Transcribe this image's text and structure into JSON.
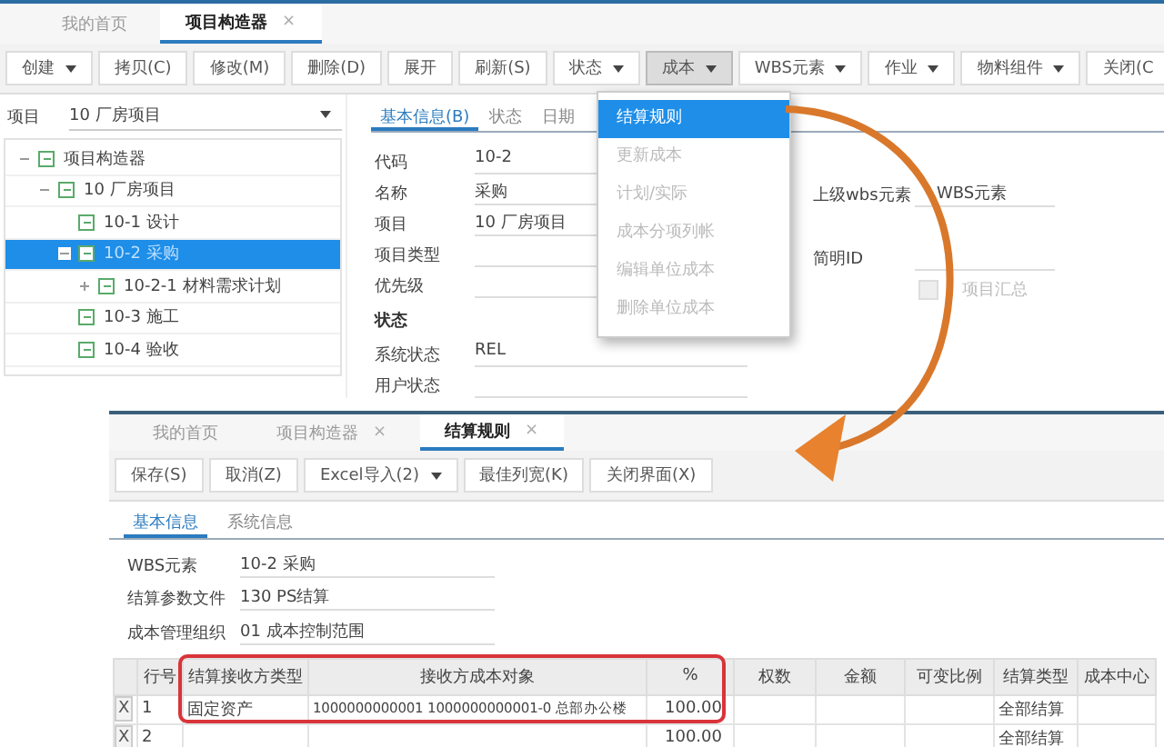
{
  "project_window": {
    "tabs": [
      {
        "label": "我的首页",
        "selected": false
      },
      {
        "label": "项目构造器",
        "selected": true,
        "close": "×"
      }
    ],
    "toolbar": [
      {
        "label": "创建",
        "dropdown": true,
        "pressed": false
      },
      {
        "label": "拷贝(C)",
        "dropdown": false,
        "pressed": false
      },
      {
        "label": "修改(M)",
        "dropdown": false,
        "pressed": false
      },
      {
        "label": "删除(D)",
        "dropdown": false,
        "pressed": false
      },
      {
        "label": "展开",
        "dropdown": false,
        "pressed": false
      },
      {
        "label": "刷新(S)",
        "dropdown": false,
        "pressed": false
      },
      {
        "label": "状态",
        "dropdown": true,
        "pressed": false
      },
      {
        "label": "成本",
        "dropdown": true,
        "pressed": true
      },
      {
        "label": "WBS元素",
        "dropdown": true,
        "pressed": false
      },
      {
        "label": "作业",
        "dropdown": true,
        "pressed": false
      },
      {
        "label": "物料组件",
        "dropdown": true,
        "pressed": false
      },
      {
        "label": "关闭(C",
        "dropdown": false,
        "pressed": false
      }
    ],
    "project_selector": {
      "label": "项目",
      "value": "10 厂房项目"
    },
    "tree": [
      {
        "label": "项目构造器",
        "expanded": true,
        "selected": false,
        "children": [
          {
            "label": "10 厂房项目",
            "expanded": true,
            "selected": false,
            "children": [
              {
                "label": "10-1 设计",
                "selected": false
              },
              {
                "label": "10-2 采购",
                "expanded": true,
                "selected": true,
                "children": [
                  {
                    "label": "10-2-1 材料需求计划",
                    "expanded": false,
                    "selected": false
                  }
                ]
              },
              {
                "label": "10-3 施工",
                "selected": false
              },
              {
                "label": "10-4 验收",
                "selected": false
              }
            ]
          }
        ]
      }
    ],
    "detail_tabs": [
      {
        "label": "基本信息(B)",
        "selected": true
      },
      {
        "label": "状态",
        "selected": false
      },
      {
        "label": "日期",
        "selected": false
      }
    ],
    "fields": [
      {
        "kind": "field",
        "label": "代码",
        "value": "10-2"
      },
      {
        "kind": "field",
        "label": "名称",
        "value": "采购"
      },
      {
        "kind": "field",
        "label": "项目",
        "value": "10 厂房项目"
      },
      {
        "kind": "field",
        "label": "项目类型"
      },
      {
        "kind": "field",
        "label": "优先级"
      },
      {
        "kind": "heading",
        "label": "状态"
      },
      {
        "kind": "field",
        "label": "系统状态",
        "value": "REL"
      },
      {
        "kind": "field",
        "label": "用户状态"
      }
    ],
    "side_fields": [
      {
        "kind": "field",
        "label": "上级wbs元素",
        "value": "WBS元素"
      },
      {
        "kind": "field",
        "label": "简明ID"
      },
      {
        "kind": "checkbox",
        "label": "项目汇总",
        "checked": false,
        "disabled": true
      }
    ],
    "cost_menu": [
      {
        "label": "结算规则",
        "selected": true,
        "disabled": false
      },
      {
        "label": "更新成本",
        "selected": false,
        "disabled": true
      },
      {
        "label": "计划/实际",
        "selected": false,
        "disabled": true
      },
      {
        "label": "成本分项列帐",
        "selected": false,
        "disabled": true
      },
      {
        "label": "编辑单位成本",
        "selected": false,
        "disabled": true
      },
      {
        "label": "删除单位成本",
        "selected": false,
        "disabled": true
      }
    ]
  },
  "settlement_window": {
    "tabs": [
      {
        "label": "我的首页",
        "selected": false
      },
      {
        "label": "项目构造器",
        "selected": false,
        "close": "×"
      },
      {
        "label": "结算规则",
        "selected": true,
        "close": "×"
      }
    ],
    "toolbar": [
      {
        "label": "保存(S)",
        "dropdown": false
      },
      {
        "label": "取消(Z)",
        "dropdown": false
      },
      {
        "label": "Excel导入(2)",
        "dropdown": true
      },
      {
        "label": "最佳列宽(K)",
        "dropdown": false
      },
      {
        "label": "关闭界面(X)",
        "dropdown": false
      }
    ],
    "sub_tabs": [
      {
        "label": "基本信息",
        "selected": true
      },
      {
        "label": "系统信息",
        "selected": false
      }
    ],
    "fields": [
      {
        "label": "WBS元素",
        "value": "10-2 采购"
      },
      {
        "label": "结算参数文件",
        "value": "130 PS结算"
      },
      {
        "label": "成本管理组织",
        "value": "01 成本控制范围"
      }
    ],
    "table": {
      "columns": [
        "行号",
        "结算接收方类型",
        "接收方成本对象",
        "%",
        "权数",
        "金额",
        "可变比例",
        "结算类型",
        "成本中心"
      ],
      "rows": [
        {
          "delete": "X",
          "cells": [
            "1",
            "固定资产",
            "1000000000001 1000000000001-0 总部办公楼",
            "100.00",
            "",
            "",
            "",
            "全部结算",
            ""
          ],
          "highlighted": true
        },
        {
          "delete": "X",
          "cells": [
            "2",
            "",
            "",
            "100.00",
            "",
            "",
            "",
            "全部结算",
            ""
          ],
          "highlighted": false
        }
      ]
    }
  }
}
